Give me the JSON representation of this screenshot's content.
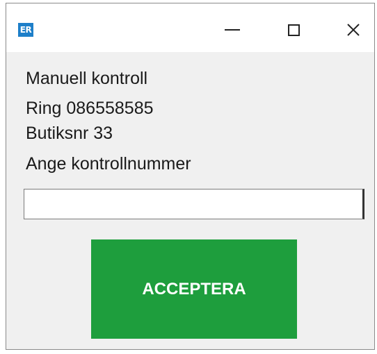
{
  "window": {
    "app_icon_text": "ER",
    "controls": {
      "minimize": "minimize-icon",
      "maximize": "maximize-icon",
      "close": "close-icon"
    }
  },
  "content": {
    "line1": "Manuell kontroll",
    "line2": "Ring 086558585",
    "line3": "Butiksnr 33",
    "line4": "Ange kontrollnummer"
  },
  "input": {
    "value": "",
    "placeholder": ""
  },
  "accept_button": {
    "label": "ACCEPTERA"
  },
  "colors": {
    "accent_green": "#1e9e3d",
    "app_icon_blue": "#1e7fc9",
    "window_bg": "#f0f0f0"
  }
}
